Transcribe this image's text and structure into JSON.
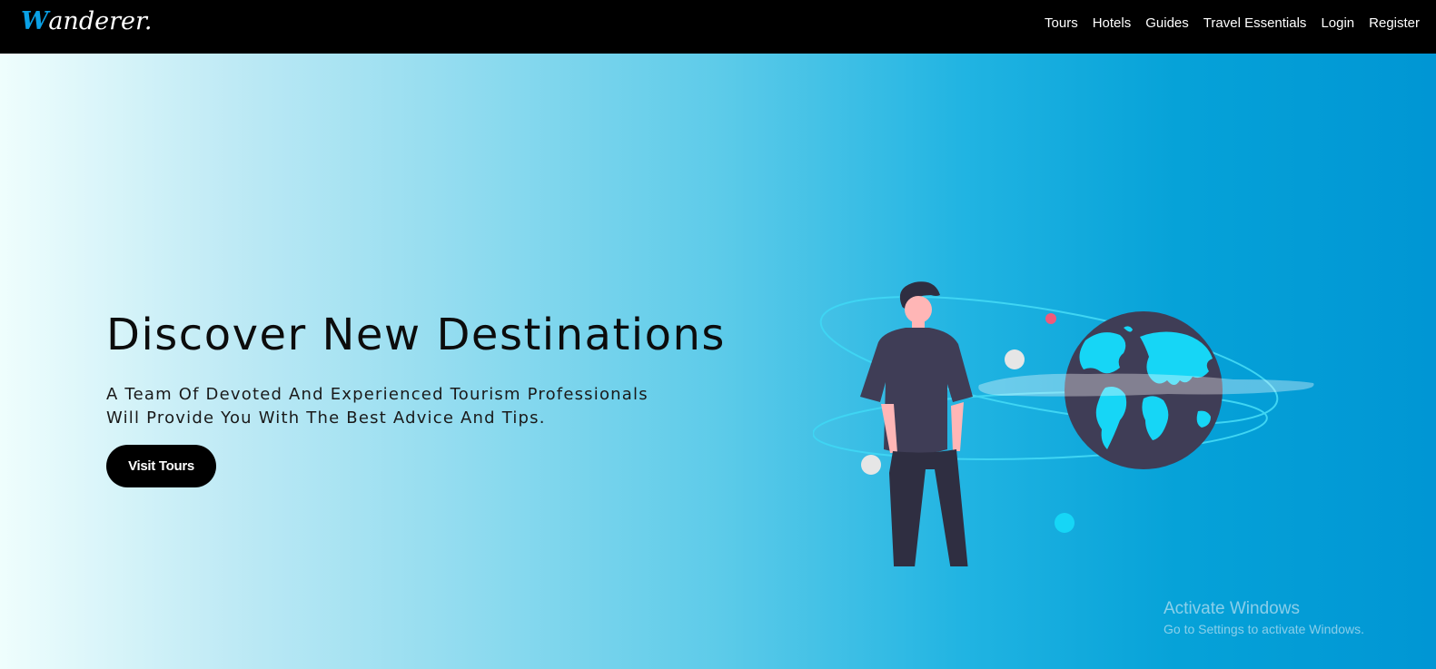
{
  "brand": {
    "logo_first_letter": "W",
    "logo_rest": "anderer.",
    "accent_color": "#0aa1e6"
  },
  "nav": {
    "items": [
      "Tours",
      "Hotels",
      "Guides",
      "Travel Essentials",
      "Login",
      "Register"
    ]
  },
  "hero": {
    "title": "Discover New Destinations",
    "description_line1": "A Team Of Devoted And Experienced Tourism Professionals",
    "description_line2": "Will Provide You With The Best Advice And Tips.",
    "button_label": "Visit Tours",
    "gradient_start": "#effefd",
    "gradient_end": "#0096d4"
  },
  "illustration": {
    "icon": "traveler-globe-illustration"
  },
  "watermark": {
    "title": "Activate Windows",
    "subtitle": "Go to Settings to activate Windows."
  }
}
